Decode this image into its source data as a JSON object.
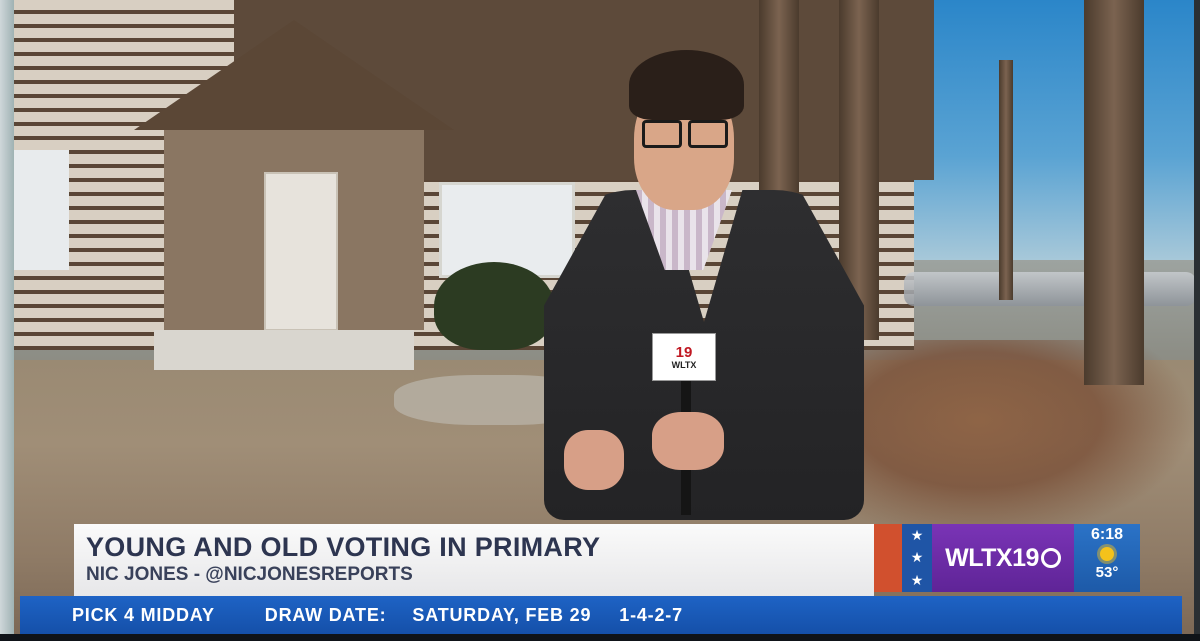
{
  "lower_third": {
    "headline": "YOUNG AND OLD VOTING IN PRIMARY",
    "byline": "NIC JONES - @NICJONESREPORTS"
  },
  "station": {
    "logo_text": "WLTX19",
    "time": "6:18",
    "temperature": "53°",
    "weather_icon": "sun-icon",
    "mic_flag_number": "19",
    "mic_flag_call": "WLTX"
  },
  "ticker": {
    "game_label": "PICK 4 MIDDAY",
    "date_label": "DRAW DATE:",
    "date_value": "SATURDAY, FEB 29",
    "numbers": "1-4-2-7"
  },
  "colors": {
    "lower_third_text": "#2d3550",
    "flag_red": "#d1502e",
    "flag_blue": "#1f55a6",
    "logo_purple": "#6a2aa6",
    "weather_blue": "#2466b8",
    "ticker_blue": "#1a5ab8"
  }
}
